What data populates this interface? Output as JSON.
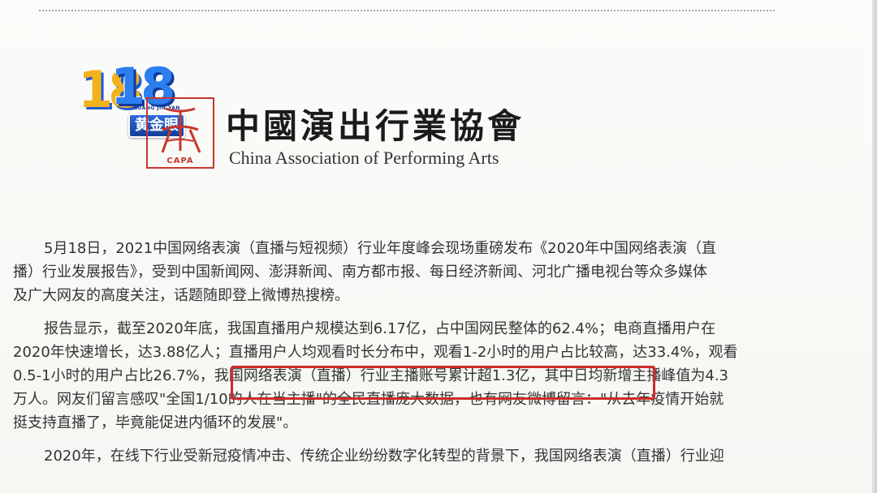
{
  "logo": {
    "number": "1818",
    "subtitle": "HUANG JIN YAN",
    "badge": "黄金眼"
  },
  "header": {
    "seal_text": "CAPA",
    "org_name_cn": "中國演出行業協會",
    "org_name_en": "China Association of Performing Arts"
  },
  "article": {
    "paragraphs": [
      {
        "lines": [
          "5月18日，2021中国网络表演（直播与短视频）行业年度峰会现场重磅发布《2020年中国网络表演（直",
          "播）行业发展报告》，受到中国新闻网、澎湃新闻、南方都市报、每日经济新闻、河北广播电视台等众多媒体",
          "及广大网友的高度关注，话题随即登上微博热搜榜。"
        ]
      },
      {
        "lines": [
          "报告显示，截至2020年底，我国直播用户规模达到6.17亿，占中国网民整体的62.4%；电商直播用户在",
          "2020年快速增长，达3.88亿人；直播用户人均观看时长分布中，观看1-2小时的用户占比较高，达33.4%，观看",
          "0.5-1小时的用户占比26.7%，我国网络表演（直播）行业主播账号累计超1.3亿，其中日均新增主播峰值为4.3",
          "万人。网友们留言感叹\"全国1/10的人在当主播\"的全民直播庞大数据，也有网友微博留言：\"从去年疫情开始就",
          "挺支持直播了，毕竟能促进内循环的发展\"。"
        ]
      },
      {
        "lines": [
          "2020年，在线下行业受新冠疫情冲击、传统企业纷纷数字化转型的背景下，我国网络表演（直播）行业迎"
        ]
      }
    ]
  }
}
